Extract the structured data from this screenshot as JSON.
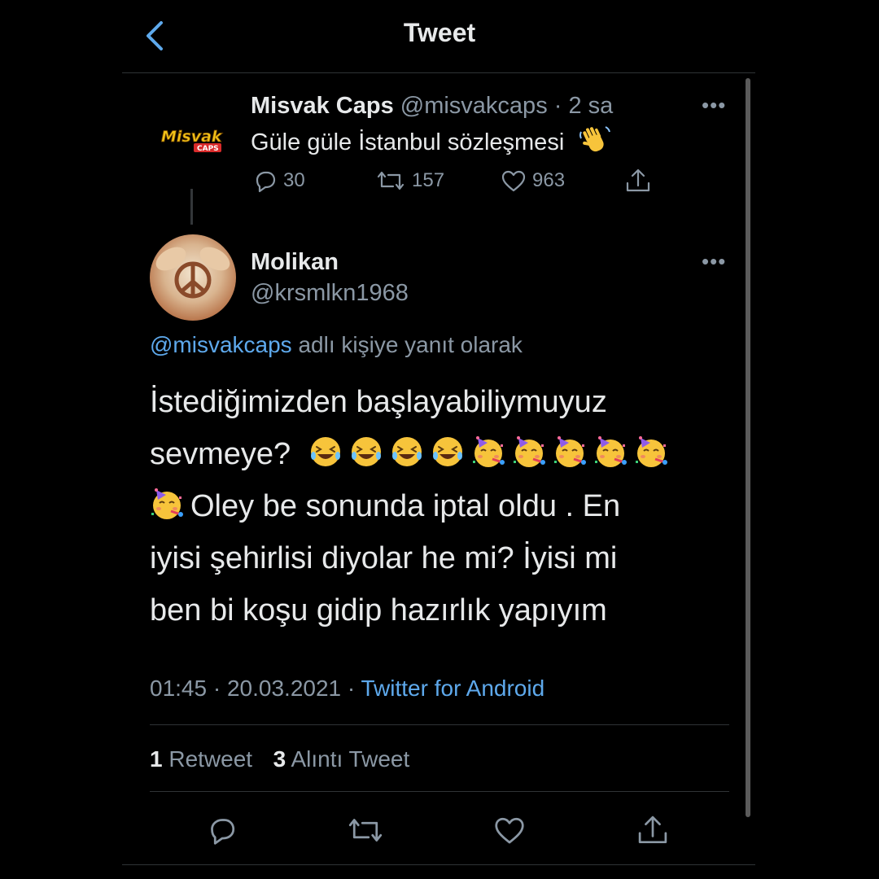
{
  "header": {
    "title": "Tweet"
  },
  "parent_tweet": {
    "name": "Misvak Caps",
    "handle": "@misvakcaps",
    "separator": "·",
    "time": "2 sa",
    "text": "Güle güle İstanbul sözleşmesi",
    "logo_text": "Misvak",
    "logo_sub": "CAPS",
    "replies": "30",
    "retweets": "157",
    "likes": "963",
    "more": "•••"
  },
  "main_tweet": {
    "name": "Molikan",
    "handle": "@krsmlkn1968",
    "more": "•••",
    "reply_to_handle": "@misvakcaps",
    "reply_to_suffix": "adlı kişiye yanıt olarak",
    "line1": "İstediğimizden başlayabiliymuyuz",
    "line2": "sevmeye?",
    "line3": "Oley be sonunda iptal oldu . En",
    "line4": "iyisi şehirlisi diyolar he mi? İyisi mi",
    "line5": "ben bi koşu gidip hazırlık yapıyım",
    "time": "01:45",
    "dot": "·",
    "date": "20.03.2021",
    "dot2": "·",
    "source": "Twitter for Android",
    "retweet_count": "1",
    "retweet_label": "Retweet",
    "quote_count": "3",
    "quote_label": "Alıntı Tweet"
  },
  "colors": {
    "background": "#000000",
    "text": "#e7e9ea",
    "muted": "#8b98a5",
    "link": "#5ea9ec",
    "divider": "#2f3336"
  },
  "icons": [
    "back-chevron-icon",
    "reply-icon",
    "retweet-icon",
    "like-icon",
    "share-icon",
    "more-icon",
    "laughing-emoji-icon",
    "party-face-emoji-icon",
    "waving-hand-emoji-icon"
  ]
}
